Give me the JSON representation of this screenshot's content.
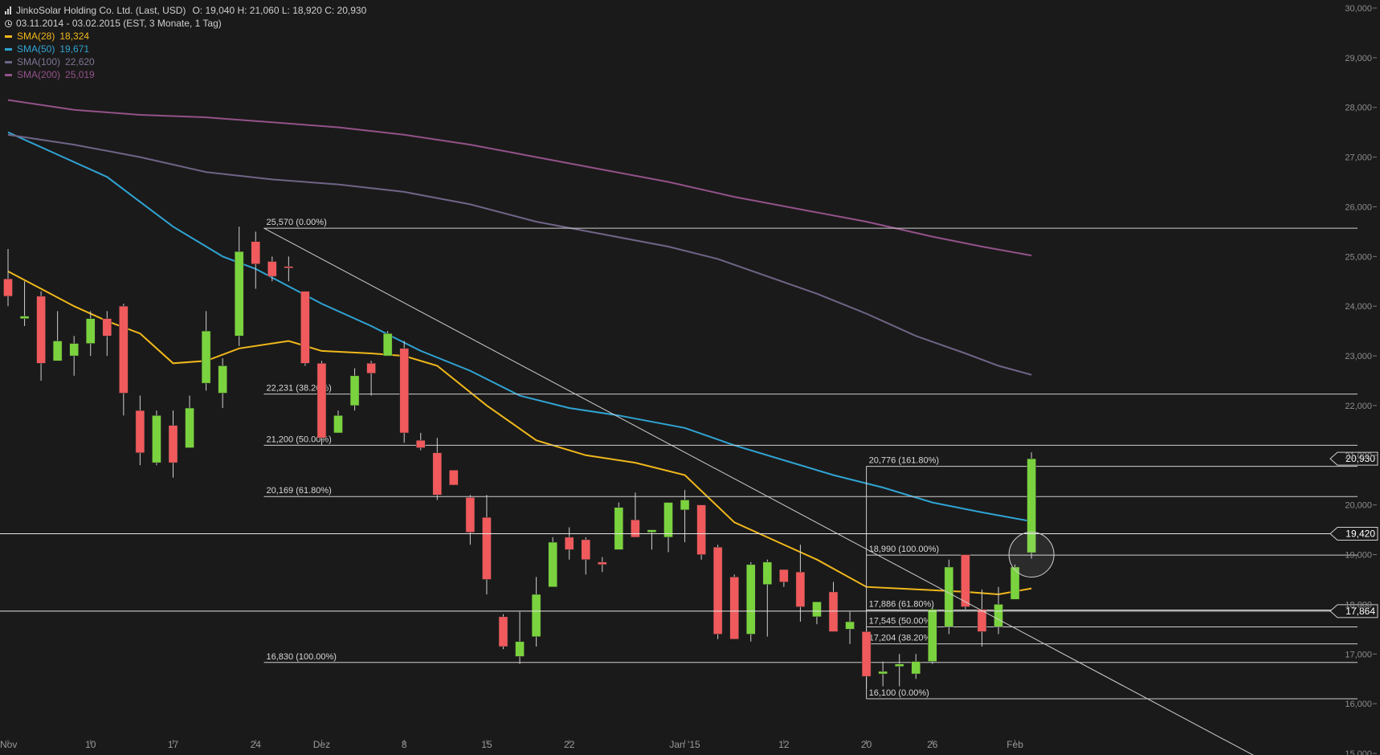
{
  "header": {
    "title": "JinkoSolar Holding Co. Ltd. (Last, USD)",
    "ohlc": "O: 19,040  H: 21,060  L: 18,920  C: 20,930",
    "range": "03.11.2014 - 03.02.2015 (EST, 3 Monate, 1 Tag)"
  },
  "legend": [
    {
      "label": "SMA(28)",
      "value": "18,324",
      "color": "#f0b81b"
    },
    {
      "label": "SMA(50)",
      "value": "19,671",
      "color": "#2fa4d4"
    },
    {
      "label": "SMA(100)",
      "value": "22,620",
      "color": "#6f6588"
    },
    {
      "label": "SMA(200)",
      "value": "25,019",
      "color": "#93528a"
    }
  ],
  "chart_data": {
    "type": "candlestick",
    "y_axis": {
      "min": 15,
      "max": 30,
      "ticks": [
        "15,000",
        "16,000",
        "17,000",
        "18,000",
        "19,000",
        "20,000",
        "21,000",
        "22,000",
        "23,000",
        "24,000",
        "25,000",
        "26,000",
        "27,000",
        "28,000",
        "29,000",
        "30,000"
      ],
      "tick_values": [
        15,
        16,
        17,
        18,
        19,
        20,
        21,
        22,
        23,
        24,
        25,
        26,
        27,
        28,
        29,
        30
      ]
    },
    "x_axis": {
      "labels": [
        {
          "text": "Nov",
          "i": 0
        },
        {
          "text": "10",
          "i": 5
        },
        {
          "text": "17",
          "i": 10
        },
        {
          "text": "24",
          "i": 15
        },
        {
          "text": "Dez",
          "i": 19
        },
        {
          "text": "8",
          "i": 24
        },
        {
          "text": "15",
          "i": 29
        },
        {
          "text": "22",
          "i": 34
        },
        {
          "text": "Jan '15",
          "i": 41
        },
        {
          "text": "12",
          "i": 47
        },
        {
          "text": "20",
          "i": 52
        },
        {
          "text": "26",
          "i": 56
        },
        {
          "text": "Feb",
          "i": 61
        }
      ]
    },
    "candles": [
      {
        "o": 24.55,
        "h": 25.15,
        "l": 24.0,
        "c": 24.2
      },
      {
        "o": 23.75,
        "h": 24.5,
        "l": 23.6,
        "c": 23.8
      },
      {
        "o": 24.2,
        "h": 24.3,
        "l": 22.5,
        "c": 22.85
      },
      {
        "o": 22.9,
        "h": 23.9,
        "l": 22.9,
        "c": 23.3
      },
      {
        "o": 23.0,
        "h": 23.4,
        "l": 22.6,
        "c": 23.25
      },
      {
        "o": 23.25,
        "h": 23.9,
        "l": 23.0,
        "c": 23.75
      },
      {
        "o": 23.75,
        "h": 23.9,
        "l": 23.0,
        "c": 23.4
      },
      {
        "o": 24.0,
        "h": 24.05,
        "l": 21.8,
        "c": 22.25
      },
      {
        "o": 21.9,
        "h": 22.2,
        "l": 20.8,
        "c": 21.05
      },
      {
        "o": 20.85,
        "h": 21.9,
        "l": 20.8,
        "c": 21.8
      },
      {
        "o": 21.6,
        "h": 21.9,
        "l": 20.55,
        "c": 20.85
      },
      {
        "o": 21.15,
        "h": 22.2,
        "l": 21.15,
        "c": 21.95
      },
      {
        "o": 22.45,
        "h": 23.9,
        "l": 22.3,
        "c": 23.5
      },
      {
        "o": 22.25,
        "h": 22.95,
        "l": 21.95,
        "c": 22.8
      },
      {
        "o": 23.4,
        "h": 25.6,
        "l": 23.2,
        "c": 25.1
      },
      {
        "o": 25.3,
        "h": 25.5,
        "l": 24.35,
        "c": 24.85
      },
      {
        "o": 24.9,
        "h": 25.0,
        "l": 24.5,
        "c": 24.6
      },
      {
        "o": 24.8,
        "h": 25.0,
        "l": 24.5,
        "c": 24.78
      },
      {
        "o": 24.3,
        "h": 24.3,
        "l": 22.8,
        "c": 22.85
      },
      {
        "o": 22.85,
        "h": 22.9,
        "l": 21.2,
        "c": 21.35
      },
      {
        "o": 21.45,
        "h": 21.9,
        "l": 21.45,
        "c": 21.8
      },
      {
        "o": 22.0,
        "h": 22.75,
        "l": 21.9,
        "c": 22.6
      },
      {
        "o": 22.85,
        "h": 22.9,
        "l": 22.2,
        "c": 22.65
      },
      {
        "o": 23.0,
        "h": 23.5,
        "l": 23.0,
        "c": 23.45
      },
      {
        "o": 23.15,
        "h": 23.3,
        "l": 21.25,
        "c": 21.45
      },
      {
        "o": 21.3,
        "h": 21.45,
        "l": 21.1,
        "c": 21.15
      },
      {
        "o": 21.05,
        "h": 21.35,
        "l": 20.1,
        "c": 20.2
      },
      {
        "o": 20.7,
        "h": 20.7,
        "l": 20.4,
        "c": 20.4
      },
      {
        "o": 20.15,
        "h": 20.2,
        "l": 19.2,
        "c": 19.45
      },
      {
        "o": 19.75,
        "h": 20.2,
        "l": 18.2,
        "c": 18.5
      },
      {
        "o": 17.75,
        "h": 17.8,
        "l": 17.1,
        "c": 17.15
      },
      {
        "o": 16.95,
        "h": 17.85,
        "l": 16.8,
        "c": 17.25
      },
      {
        "o": 17.35,
        "h": 18.55,
        "l": 17.15,
        "c": 18.2
      },
      {
        "o": 18.35,
        "h": 19.35,
        "l": 18.35,
        "c": 19.25
      },
      {
        "o": 19.35,
        "h": 19.55,
        "l": 18.9,
        "c": 19.1
      },
      {
        "o": 19.3,
        "h": 19.35,
        "l": 18.6,
        "c": 18.9
      },
      {
        "o": 18.85,
        "h": 18.95,
        "l": 18.65,
        "c": 18.8
      },
      {
        "o": 19.1,
        "h": 20.05,
        "l": 19.1,
        "c": 19.95
      },
      {
        "o": 19.7,
        "h": 20.25,
        "l": 19.35,
        "c": 19.35
      },
      {
        "o": 19.45,
        "h": 19.5,
        "l": 19.1,
        "c": 19.5
      },
      {
        "o": 19.35,
        "h": 20.05,
        "l": 19.05,
        "c": 20.05
      },
      {
        "o": 19.9,
        "h": 20.3,
        "l": 19.25,
        "c": 20.1
      },
      {
        "o": 20.0,
        "h": 20.0,
        "l": 18.9,
        "c": 19.0
      },
      {
        "o": 19.15,
        "h": 19.2,
        "l": 17.3,
        "c": 17.4
      },
      {
        "o": 18.55,
        "h": 18.6,
        "l": 17.3,
        "c": 17.3
      },
      {
        "o": 17.4,
        "h": 18.85,
        "l": 17.25,
        "c": 18.8
      },
      {
        "o": 18.4,
        "h": 18.9,
        "l": 17.35,
        "c": 18.85
      },
      {
        "o": 18.7,
        "h": 18.7,
        "l": 18.35,
        "c": 18.45
      },
      {
        "o": 18.65,
        "h": 19.2,
        "l": 17.65,
        "c": 17.95
      },
      {
        "o": 17.75,
        "h": 18.0,
        "l": 17.6,
        "c": 18.05
      },
      {
        "o": 18.25,
        "h": 18.45,
        "l": 17.45,
        "c": 17.45
      },
      {
        "o": 17.5,
        "h": 17.85,
        "l": 17.2,
        "c": 17.65
      },
      {
        "o": 17.45,
        "h": 17.5,
        "l": 16.3,
        "c": 16.55
      },
      {
        "o": 16.6,
        "h": 16.85,
        "l": 16.35,
        "c": 16.65
      },
      {
        "o": 16.75,
        "h": 17.0,
        "l": 16.35,
        "c": 16.8
      },
      {
        "o": 16.6,
        "h": 17.0,
        "l": 16.5,
        "c": 16.85
      },
      {
        "o": 16.85,
        "h": 17.95,
        "l": 16.8,
        "c": 17.9
      },
      {
        "o": 17.55,
        "h": 18.9,
        "l": 17.4,
        "c": 18.75
      },
      {
        "o": 19.0,
        "h": 19.0,
        "l": 17.9,
        "c": 17.95
      },
      {
        "o": 17.9,
        "h": 18.3,
        "l": 17.15,
        "c": 17.45
      },
      {
        "o": 17.55,
        "h": 18.35,
        "l": 17.4,
        "c": 18.0
      },
      {
        "o": 18.1,
        "h": 18.8,
        "l": 18.1,
        "c": 18.75
      },
      {
        "o": 19.04,
        "h": 21.06,
        "l": 18.92,
        "c": 20.93
      }
    ],
    "sma": [
      {
        "name": "SMA(28)",
        "color": "#f0b81b",
        "points": [
          [
            0,
            24.7
          ],
          [
            2,
            24.35
          ],
          [
            4,
            24.0
          ],
          [
            6,
            23.7
          ],
          [
            8,
            23.45
          ],
          [
            10,
            22.85
          ],
          [
            12,
            22.9
          ],
          [
            14,
            23.15
          ],
          [
            17,
            23.3
          ],
          [
            19,
            23.1
          ],
          [
            22,
            23.05
          ],
          [
            24,
            23.0
          ],
          [
            26,
            22.8
          ],
          [
            29,
            22.0
          ],
          [
            32,
            21.3
          ],
          [
            35,
            21.0
          ],
          [
            38,
            20.85
          ],
          [
            41,
            20.6
          ],
          [
            44,
            19.65
          ],
          [
            46,
            19.35
          ],
          [
            49,
            18.9
          ],
          [
            52,
            18.35
          ],
          [
            55,
            18.3
          ],
          [
            58,
            18.25
          ],
          [
            60,
            18.2
          ],
          [
            62,
            18.32
          ]
        ]
      },
      {
        "name": "SMA(50)",
        "color": "#2fa4d4",
        "points": [
          [
            0,
            27.5
          ],
          [
            3,
            27.05
          ],
          [
            6,
            26.6
          ],
          [
            8,
            26.1
          ],
          [
            10,
            25.6
          ],
          [
            13,
            25.0
          ],
          [
            15,
            24.75
          ],
          [
            17,
            24.4
          ],
          [
            19,
            24.05
          ],
          [
            22,
            23.6
          ],
          [
            25,
            23.1
          ],
          [
            28,
            22.7
          ],
          [
            31,
            22.2
          ],
          [
            34,
            21.95
          ],
          [
            37,
            21.8
          ],
          [
            41,
            21.55
          ],
          [
            44,
            21.2
          ],
          [
            47,
            20.9
          ],
          [
            50,
            20.6
          ],
          [
            53,
            20.35
          ],
          [
            56,
            20.05
          ],
          [
            59,
            19.85
          ],
          [
            62,
            19.67
          ]
        ]
      },
      {
        "name": "SMA(100)",
        "color": "#6f6588",
        "points": [
          [
            0,
            27.45
          ],
          [
            4,
            27.25
          ],
          [
            8,
            27.0
          ],
          [
            12,
            26.7
          ],
          [
            16,
            26.55
          ],
          [
            20,
            26.45
          ],
          [
            24,
            26.3
          ],
          [
            28,
            26.05
          ],
          [
            32,
            25.7
          ],
          [
            36,
            25.45
          ],
          [
            40,
            25.2
          ],
          [
            43,
            24.95
          ],
          [
            46,
            24.6
          ],
          [
            49,
            24.25
          ],
          [
            52,
            23.85
          ],
          [
            55,
            23.4
          ],
          [
            58,
            23.05
          ],
          [
            60,
            22.8
          ],
          [
            62,
            22.62
          ]
        ]
      },
      {
        "name": "SMA(200)",
        "color": "#93528a",
        "points": [
          [
            0,
            28.15
          ],
          [
            4,
            27.95
          ],
          [
            8,
            27.85
          ],
          [
            12,
            27.8
          ],
          [
            16,
            27.7
          ],
          [
            20,
            27.6
          ],
          [
            24,
            27.45
          ],
          [
            28,
            27.25
          ],
          [
            32,
            27.0
          ],
          [
            36,
            26.75
          ],
          [
            40,
            26.5
          ],
          [
            44,
            26.2
          ],
          [
            48,
            25.95
          ],
          [
            52,
            25.7
          ],
          [
            56,
            25.4
          ],
          [
            59,
            25.2
          ],
          [
            62,
            25.02
          ]
        ]
      }
    ],
    "fib_levels": [
      {
        "label": "25,570 (0.00%)",
        "value": 25.57,
        "start": 15.5
      },
      {
        "label": "22,231 (38.20%)",
        "value": 22.231,
        "start": 15.5
      },
      {
        "label": "21,200 (50.00%)",
        "value": 21.2,
        "start": 15.5
      },
      {
        "label": "20,169 (61.80%)",
        "value": 20.169,
        "start": 15.5
      },
      {
        "label": "16,830 (100.00%)",
        "value": 16.83,
        "start": 15.5
      },
      {
        "label": "20,776 (161.80%)",
        "value": 20.776,
        "start": 52.0
      },
      {
        "label": "18,990 (100.00%)",
        "value": 18.99,
        "start": 52.0
      },
      {
        "label": "17,886 (61.80%)",
        "value": 17.886,
        "start": 52.0
      },
      {
        "label": "17,545 (50.00%)",
        "value": 17.545,
        "start": 52.0
      },
      {
        "label": "17,204 (38.20%)",
        "value": 17.204,
        "start": 52.0
      },
      {
        "label": "16,100 (0.00%)",
        "value": 16.1,
        "start": 52.0
      }
    ],
    "horizontal_lines": [
      {
        "label": "19,420",
        "value": 19.42
      },
      {
        "label": "17,864",
        "value": 17.864
      }
    ],
    "last_price": {
      "label": "20,930",
      "value": 20.93
    },
    "trendline": {
      "from": [
        15.5,
        25.57
      ],
      "to": [
        77.5,
        14.6
      ]
    },
    "highlight_circle": {
      "i": 62,
      "value": 19.0
    }
  }
}
